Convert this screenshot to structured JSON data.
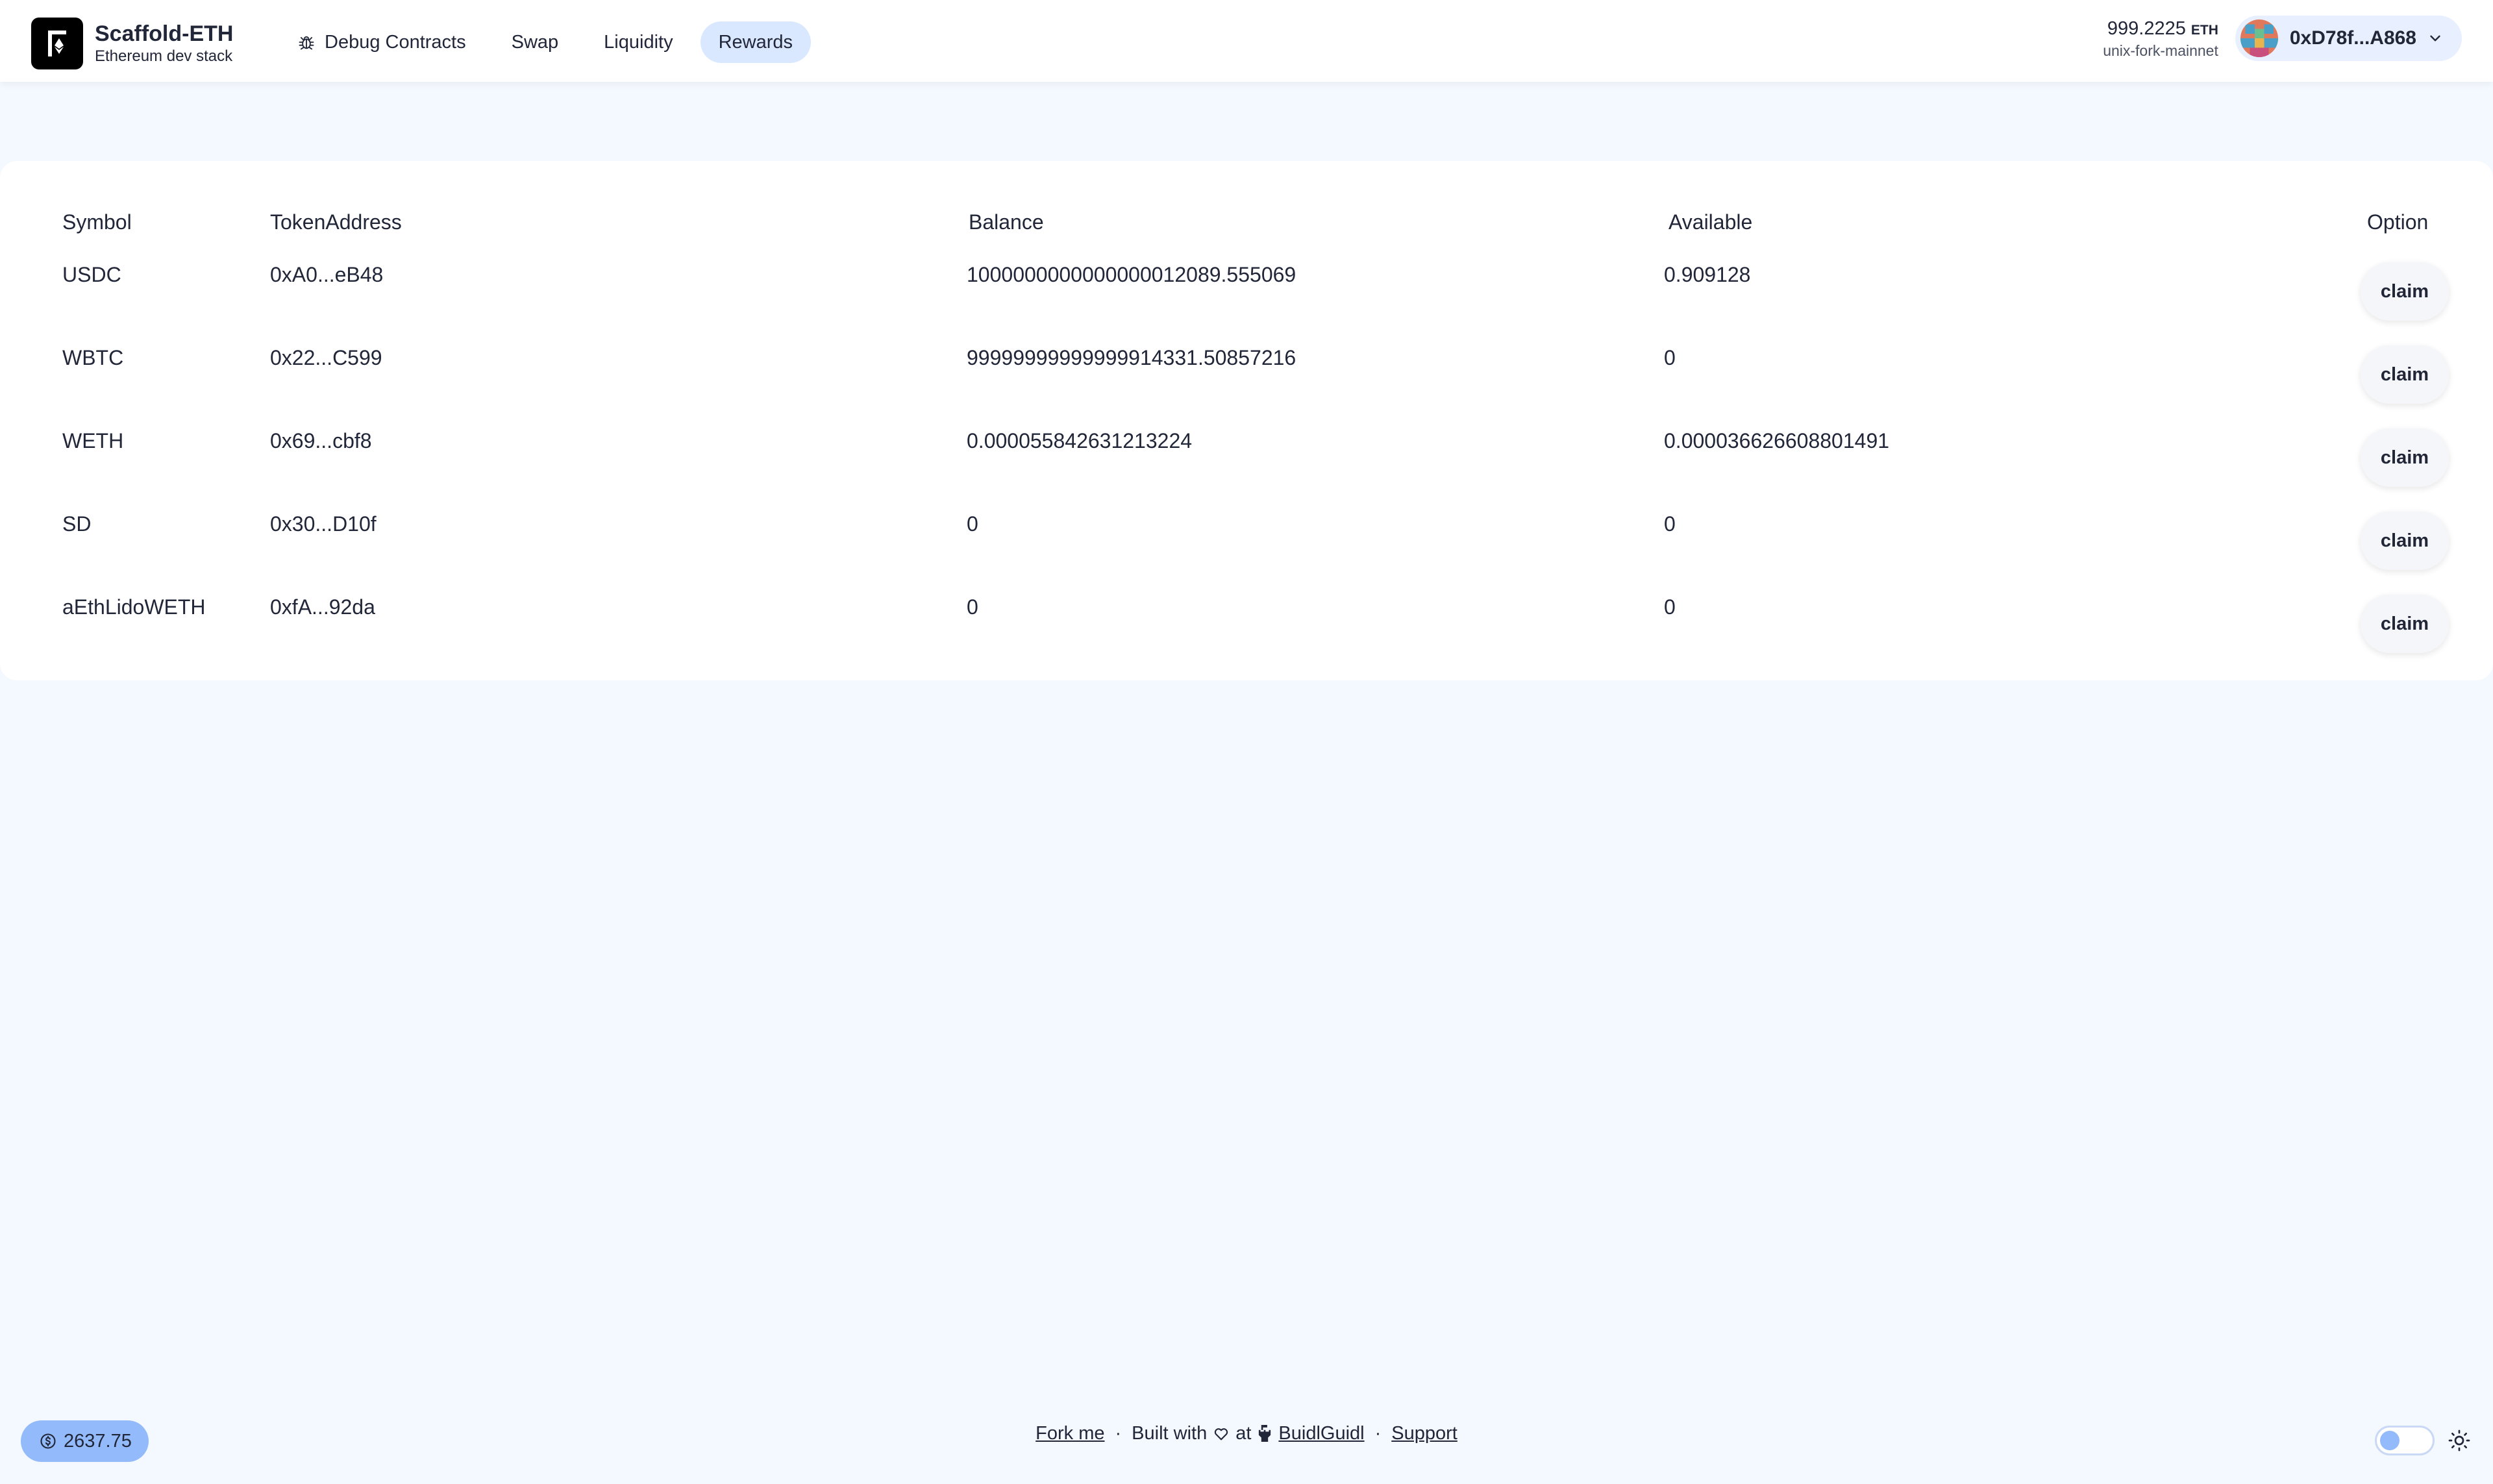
{
  "header": {
    "brand_title": "Scaffold-ETH",
    "brand_subtitle": "Ethereum dev stack",
    "nav": [
      {
        "label": "Debug Contracts",
        "icon": "bug-icon",
        "active": false
      },
      {
        "label": "Swap",
        "active": false
      },
      {
        "label": "Liquidity",
        "active": false
      },
      {
        "label": "Rewards",
        "active": true
      }
    ],
    "wallet": {
      "balance": "999.2225",
      "unit": "ETH",
      "network": "unix-fork-mainnet",
      "address": "0xD78f...A868"
    }
  },
  "table": {
    "columns": [
      "Symbol",
      "TokenAddress",
      "Balance",
      "Available",
      "Option"
    ],
    "rows": [
      {
        "symbol": "USDC",
        "address": "0xA0...eB48",
        "balance": "1000000000000000012089.555069",
        "available": "0.909128",
        "action": "claim"
      },
      {
        "symbol": "WBTC",
        "address": "0x22...C599",
        "balance": "99999999999999914331.50857216",
        "available": "0",
        "action": "claim"
      },
      {
        "symbol": "WETH",
        "address": "0x69...cbf8",
        "balance": "0.000055842631213224",
        "available": "0.000036626608801491",
        "action": "claim"
      },
      {
        "symbol": "SD",
        "address": "0x30...D10f",
        "balance": "0",
        "available": "0",
        "action": "claim"
      },
      {
        "symbol": "aEthLidoWETH",
        "address": "0xfA...92da",
        "balance": "0",
        "available": "0",
        "action": "claim"
      }
    ]
  },
  "footer": {
    "eth_price": "2637.75",
    "fork_me": "Fork me",
    "built_with": "Built with",
    "at": "at",
    "buidlguidl": "BuidlGuidl",
    "support": "Support",
    "separator": "·"
  },
  "colors": {
    "page_bg": "#f4f8ff",
    "accent": "#93bbfb",
    "active_nav": "#dae8ff"
  }
}
